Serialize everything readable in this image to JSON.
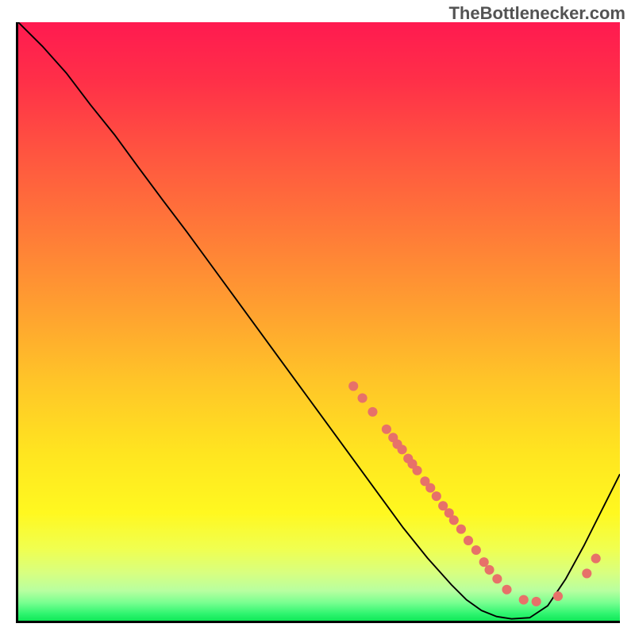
{
  "attribution": "TheBottlenecker.com",
  "chart_data": {
    "type": "line",
    "title": "",
    "xlabel": "",
    "ylabel": "",
    "xlim": [
      0,
      1
    ],
    "ylim": [
      0,
      1
    ],
    "curve_points": [
      {
        "x": 0.0,
        "y": 1.0
      },
      {
        "x": 0.04,
        "y": 0.96
      },
      {
        "x": 0.08,
        "y": 0.915
      },
      {
        "x": 0.12,
        "y": 0.862
      },
      {
        "x": 0.16,
        "y": 0.812
      },
      {
        "x": 0.2,
        "y": 0.757
      },
      {
        "x": 0.24,
        "y": 0.703
      },
      {
        "x": 0.28,
        "y": 0.65
      },
      {
        "x": 0.32,
        "y": 0.595
      },
      {
        "x": 0.36,
        "y": 0.54
      },
      {
        "x": 0.4,
        "y": 0.485
      },
      {
        "x": 0.44,
        "y": 0.43
      },
      {
        "x": 0.48,
        "y": 0.375
      },
      {
        "x": 0.52,
        "y": 0.32
      },
      {
        "x": 0.56,
        "y": 0.265
      },
      {
        "x": 0.6,
        "y": 0.21
      },
      {
        "x": 0.64,
        "y": 0.155
      },
      {
        "x": 0.68,
        "y": 0.105
      },
      {
        "x": 0.72,
        "y": 0.06
      },
      {
        "x": 0.745,
        "y": 0.035
      },
      {
        "x": 0.77,
        "y": 0.017
      },
      {
        "x": 0.795,
        "y": 0.007
      },
      {
        "x": 0.82,
        "y": 0.003
      },
      {
        "x": 0.85,
        "y": 0.005
      },
      {
        "x": 0.88,
        "y": 0.025
      },
      {
        "x": 0.91,
        "y": 0.07
      },
      {
        "x": 0.94,
        "y": 0.125
      },
      {
        "x": 0.97,
        "y": 0.185
      },
      {
        "x": 1.0,
        "y": 0.245
      }
    ],
    "markers": [
      {
        "x": 0.557,
        "y": 0.392
      },
      {
        "x": 0.572,
        "y": 0.372
      },
      {
        "x": 0.589,
        "y": 0.349
      },
      {
        "x": 0.612,
        "y": 0.32
      },
      {
        "x": 0.623,
        "y": 0.306
      },
      {
        "x": 0.63,
        "y": 0.295
      },
      {
        "x": 0.638,
        "y": 0.286
      },
      {
        "x": 0.648,
        "y": 0.271
      },
      {
        "x": 0.655,
        "y": 0.262
      },
      {
        "x": 0.663,
        "y": 0.251
      },
      {
        "x": 0.676,
        "y": 0.233
      },
      {
        "x": 0.685,
        "y": 0.222
      },
      {
        "x": 0.695,
        "y": 0.208
      },
      {
        "x": 0.706,
        "y": 0.192
      },
      {
        "x": 0.716,
        "y": 0.18
      },
      {
        "x": 0.724,
        "y": 0.168
      },
      {
        "x": 0.736,
        "y": 0.153
      },
      {
        "x": 0.748,
        "y": 0.134
      },
      {
        "x": 0.761,
        "y": 0.118
      },
      {
        "x": 0.774,
        "y": 0.098
      },
      {
        "x": 0.783,
        "y": 0.085
      },
      {
        "x": 0.796,
        "y": 0.07
      },
      {
        "x": 0.812,
        "y": 0.052
      },
      {
        "x": 0.84,
        "y": 0.035
      },
      {
        "x": 0.861,
        "y": 0.032
      },
      {
        "x": 0.897,
        "y": 0.041
      },
      {
        "x": 0.945,
        "y": 0.079
      },
      {
        "x": 0.96,
        "y": 0.104
      }
    ],
    "marker_style": {
      "color": "#e77169",
      "radius": 8
    },
    "line_style": {
      "color": "#000000",
      "width": 2.5
    },
    "gradient_stops": [
      {
        "offset": 0.0,
        "color": "#ff1a50"
      },
      {
        "offset": 0.1,
        "color": "#ff3048"
      },
      {
        "offset": 0.22,
        "color": "#ff5540"
      },
      {
        "offset": 0.35,
        "color": "#ff7a38"
      },
      {
        "offset": 0.48,
        "color": "#ffa030"
      },
      {
        "offset": 0.6,
        "color": "#ffc528"
      },
      {
        "offset": 0.72,
        "color": "#ffe520"
      },
      {
        "offset": 0.82,
        "color": "#fff820"
      },
      {
        "offset": 0.88,
        "color": "#f0ff50"
      },
      {
        "offset": 0.92,
        "color": "#d8ff80"
      },
      {
        "offset": 0.95,
        "color": "#b8ffa0"
      },
      {
        "offset": 0.97,
        "color": "#78ff90"
      },
      {
        "offset": 0.988,
        "color": "#30f570"
      },
      {
        "offset": 1.0,
        "color": "#10e858"
      }
    ]
  }
}
